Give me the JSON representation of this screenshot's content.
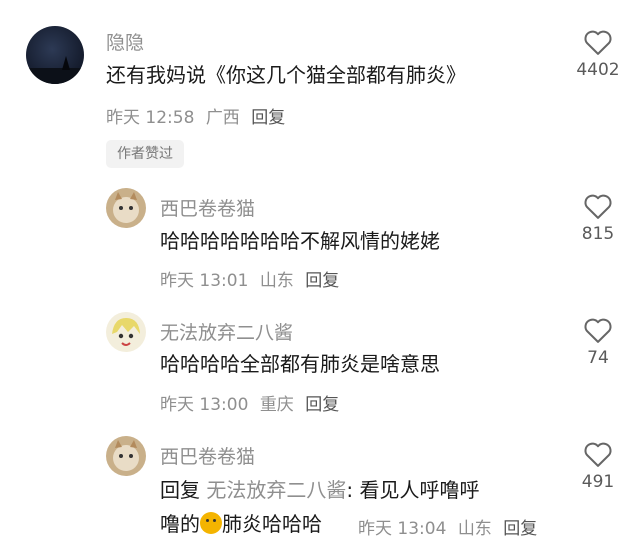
{
  "comments": [
    {
      "username": "隐隐",
      "text": "还有我妈说《你这几个猫全部都有肺炎》",
      "time": "昨天 12:58",
      "location": "广西",
      "reply_label": "回复",
      "likes": "4402",
      "badge": "作者赞过",
      "avatar_icon": "night-sky-avatar"
    },
    {
      "username": "西巴卷卷猫",
      "text": "哈哈哈哈哈哈哈不解风情的姥姥",
      "time": "昨天 13:01",
      "location": "山东",
      "reply_label": "回复",
      "likes": "815",
      "avatar_icon": "cat-avatar"
    },
    {
      "username": "无法放弃二八酱",
      "text": "哈哈哈哈全部都有肺炎是啥意思",
      "time": "昨天 13:00",
      "location": "重庆",
      "reply_label": "回复",
      "likes": "74",
      "avatar_icon": "anime-avatar"
    },
    {
      "username": "西巴卷卷猫",
      "reply_prefix": "回复 ",
      "reply_target": "无法放弃二八酱",
      "text_line1": ": 看见人呼噜呼",
      "text_line2_a": "噜的",
      "text_line2_b": "肺炎哈哈哈",
      "emoji_icon": "shiba-emoji",
      "time": "昨天 13:04",
      "location": "山东",
      "reply_label": "回复",
      "likes": "491",
      "avatar_icon": "cat-avatar"
    }
  ],
  "colors": {
    "secondary_text": "#8f8f8f",
    "primary_text": "#1a1a1a",
    "badge_bg": "#f2f2f2"
  }
}
